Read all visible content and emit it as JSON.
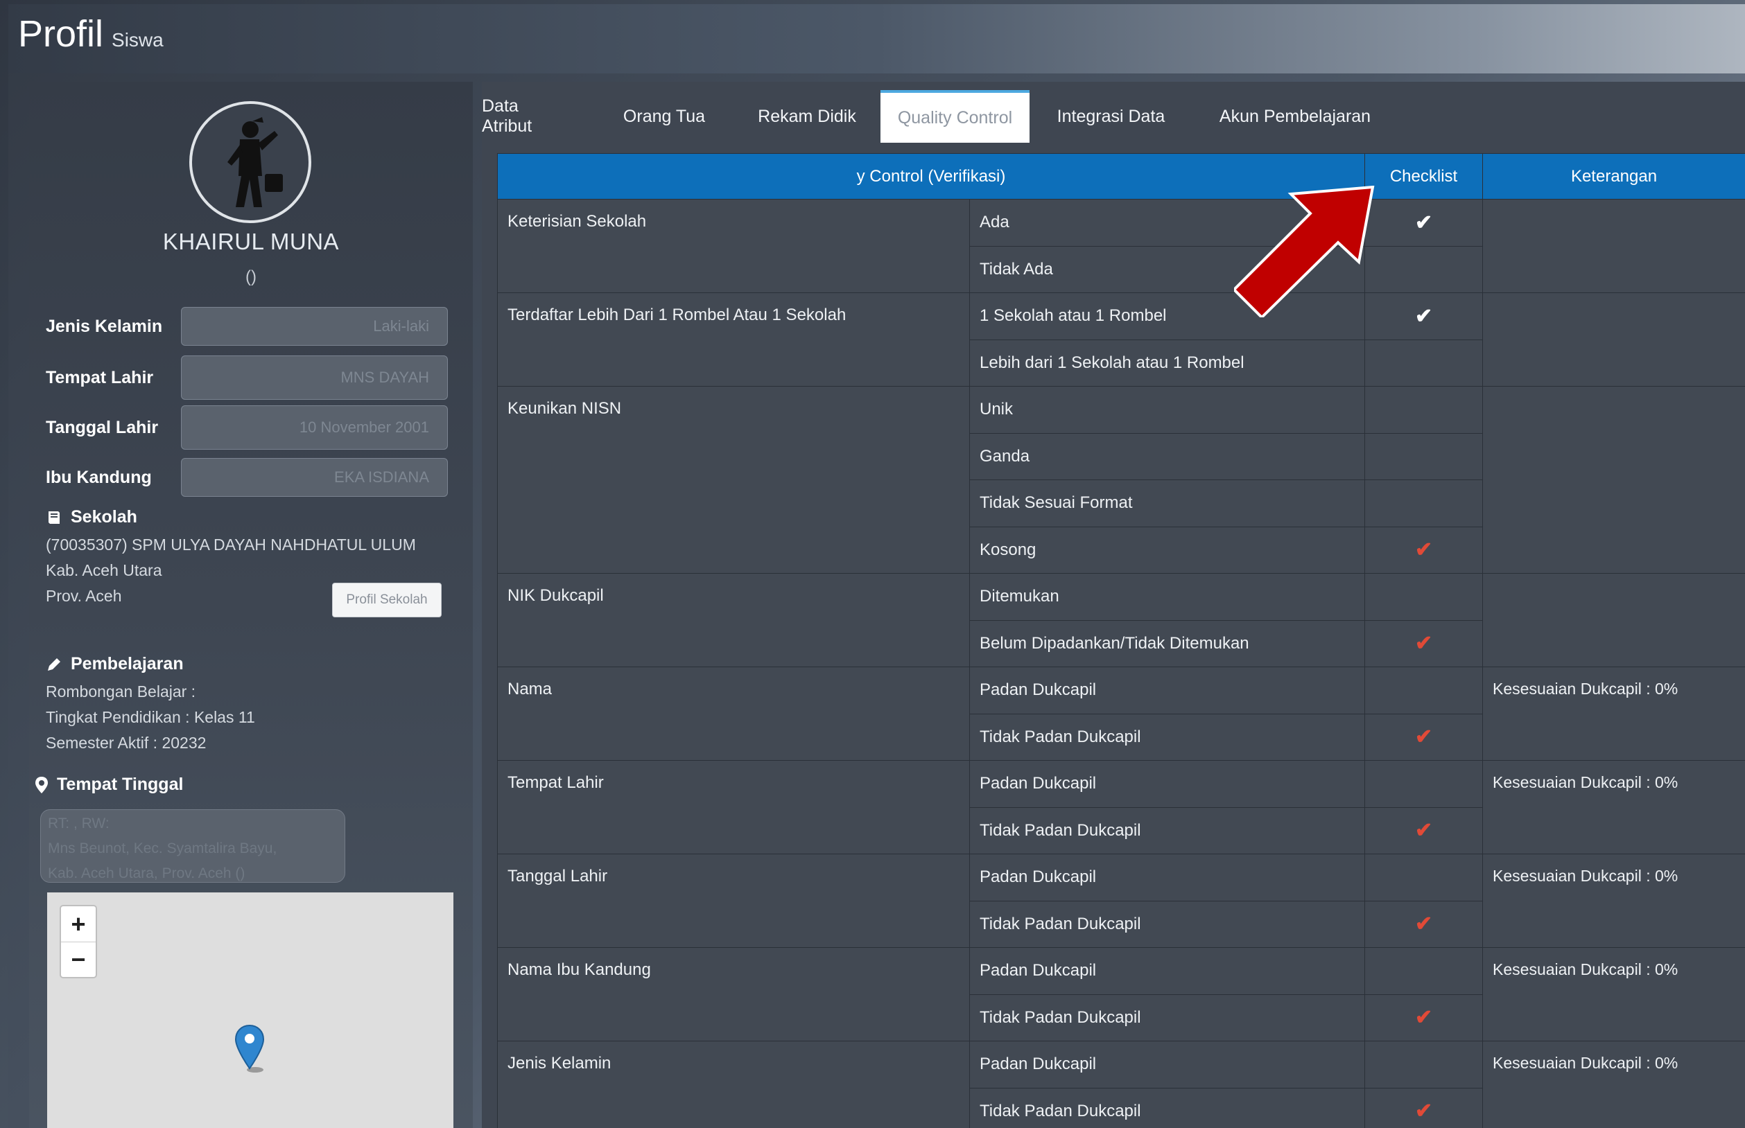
{
  "header": {
    "title": "Profil",
    "subtitle": "Siswa"
  },
  "profile": {
    "name": "KHAIRUL MUNA",
    "sub": "()",
    "fields": [
      {
        "label": "Jenis Kelamin",
        "value": "Laki-laki"
      },
      {
        "label": "Tempat Lahir",
        "value": "MNS DAYAH"
      },
      {
        "label": "Tanggal Lahir",
        "value": "10 November 2001"
      },
      {
        "label": "Ibu Kandung",
        "value": "EKA ISDIANA"
      }
    ],
    "sekolah": {
      "heading": "Sekolah",
      "line1": "(70035307) SPM ULYA DAYAH NAHDHATUL ULUM",
      "line2": "Kab. Aceh Utara",
      "line3": "Prov. Aceh",
      "button": "Profil Sekolah"
    },
    "pembelajaran": {
      "heading": "Pembelajaran",
      "line1": "Rombongan Belajar :",
      "line2": "Tingkat Pendidikan : Kelas 11",
      "line3": "Semester Aktif : 20232"
    },
    "tempat_tinggal": {
      "heading": "Tempat Tinggal",
      "line1": "RT: , RW:",
      "line2": "Mns Beunot, Kec. Syamtalira Bayu,",
      "line3": "Kab. Aceh Utara, Prov. Aceh ()"
    },
    "map": {
      "zoom_in": "+",
      "zoom_out": "−"
    }
  },
  "tabs": [
    "Data Atribut",
    "Orang Tua",
    "Rekam Didik",
    "Quality Control",
    "Integrasi Data",
    "Akun Pembelajaran"
  ],
  "active_tab": "Quality Control",
  "table": {
    "headers": {
      "verifikasi": "y Control (Verifikasi)",
      "checklist": "Checklist",
      "keterangan": "Keterangan"
    },
    "groups": [
      {
        "category": "Keterisian Sekolah",
        "keterangan": "",
        "rows": [
          {
            "label": "Ada",
            "check": "white"
          },
          {
            "label": "Tidak Ada",
            "check": ""
          }
        ]
      },
      {
        "category": "Terdaftar Lebih Dari 1 Rombel Atau 1 Sekolah",
        "keterangan": "",
        "rows": [
          {
            "label": "1 Sekolah atau 1 Rombel",
            "check": "white"
          },
          {
            "label": "Lebih dari 1 Sekolah atau 1 Rombel",
            "check": ""
          }
        ]
      },
      {
        "category": "Keunikan NISN",
        "keterangan": "",
        "rows": [
          {
            "label": "Unik",
            "check": ""
          },
          {
            "label": "Ganda",
            "check": ""
          },
          {
            "label": "Tidak Sesuai Format",
            "check": ""
          },
          {
            "label": "Kosong",
            "check": "red"
          }
        ]
      },
      {
        "category": "NIK Dukcapil",
        "keterangan": "",
        "rows": [
          {
            "label": "Ditemukan",
            "check": ""
          },
          {
            "label": "Belum Dipadankan/Tidak Ditemukan",
            "check": "red"
          }
        ]
      },
      {
        "category": "Nama",
        "keterangan": "Kesesuaian Dukcapil : 0%",
        "rows": [
          {
            "label": "Padan Dukcapil",
            "check": ""
          },
          {
            "label": "Tidak Padan Dukcapil",
            "check": "red"
          }
        ]
      },
      {
        "category": "Tempat Lahir",
        "keterangan": "Kesesuaian Dukcapil : 0%",
        "rows": [
          {
            "label": "Padan Dukcapil",
            "check": ""
          },
          {
            "label": "Tidak Padan Dukcapil",
            "check": "red"
          }
        ]
      },
      {
        "category": "Tanggal Lahir",
        "keterangan": "Kesesuaian Dukcapil : 0%",
        "rows": [
          {
            "label": "Padan Dukcapil",
            "check": ""
          },
          {
            "label": "Tidak Padan Dukcapil",
            "check": "red"
          }
        ]
      },
      {
        "category": "Nama Ibu Kandung",
        "keterangan": "Kesesuaian Dukcapil : 0%",
        "rows": [
          {
            "label": "Padan Dukcapil",
            "check": ""
          },
          {
            "label": "Tidak Padan Dukcapil",
            "check": "red"
          }
        ]
      },
      {
        "category": "Jenis Kelamin",
        "keterangan": "Kesesuaian Dukcapil : 0%",
        "rows": [
          {
            "label": "Padan Dukcapil",
            "check": ""
          },
          {
            "label": "Tidak Padan Dukcapil",
            "check": "red"
          }
        ]
      }
    ]
  },
  "colors": {
    "header_blue": "#0d6fba",
    "check_red": "#e14a37",
    "arrow_red": "#c00000",
    "tab_active_border": "#4da9e0"
  }
}
